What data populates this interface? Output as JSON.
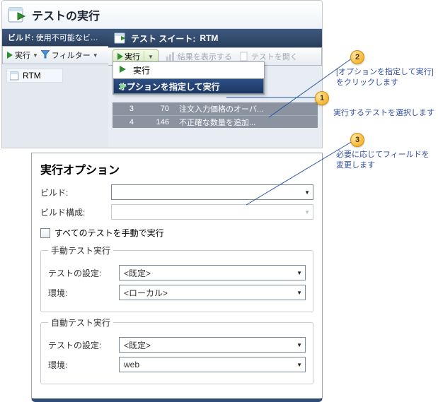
{
  "header": {
    "title": "テストの実行"
  },
  "left": {
    "build_label": "ビルド:",
    "build_value": "使用不可能なビルド",
    "run_label": "実行",
    "filter_label": "フィルター",
    "tree_item": "RTM"
  },
  "suite": {
    "prefix": "テスト スイート:",
    "name": "RTM"
  },
  "right_toolbar": {
    "run_label": "実行",
    "results_label": "結果を表示する",
    "open_label": "テストを開く"
  },
  "menu": {
    "items": [
      {
        "label": "実行"
      },
      {
        "label": "オプションを指定して実行"
      }
    ],
    "selected_index": 1
  },
  "grid": {
    "rows": [
      {
        "c1": "3",
        "c2": "70",
        "c3": "注文入力価格のオーバ..."
      },
      {
        "c1": "4",
        "c2": "146",
        "c3": "不正確な数量を追加..."
      }
    ]
  },
  "dialog": {
    "title": "実行オプション",
    "build_label": "ビルド:",
    "build_value": "",
    "build_cfg_label": "ビルド構成:",
    "build_cfg_value": "",
    "manual_all_label": "すべてのテストを手動で実行",
    "manual_group": "手動テスト実行",
    "auto_group": "自動テスト実行",
    "settings_label": "テストの設定:",
    "env_label": "環境:",
    "manual_settings_value": "<既定>",
    "manual_env_value": "<ローカル>",
    "auto_settings_value": "<既定>",
    "auto_env_value": "web"
  },
  "callouts": {
    "c1": {
      "num": "1",
      "text": "実行するテストを選択します"
    },
    "c2": {
      "num": "2",
      "text": "[オプションを指定して実行] をクリックします"
    },
    "c3": {
      "num": "3",
      "text": "必要に応じてフィールドを変更します"
    }
  }
}
